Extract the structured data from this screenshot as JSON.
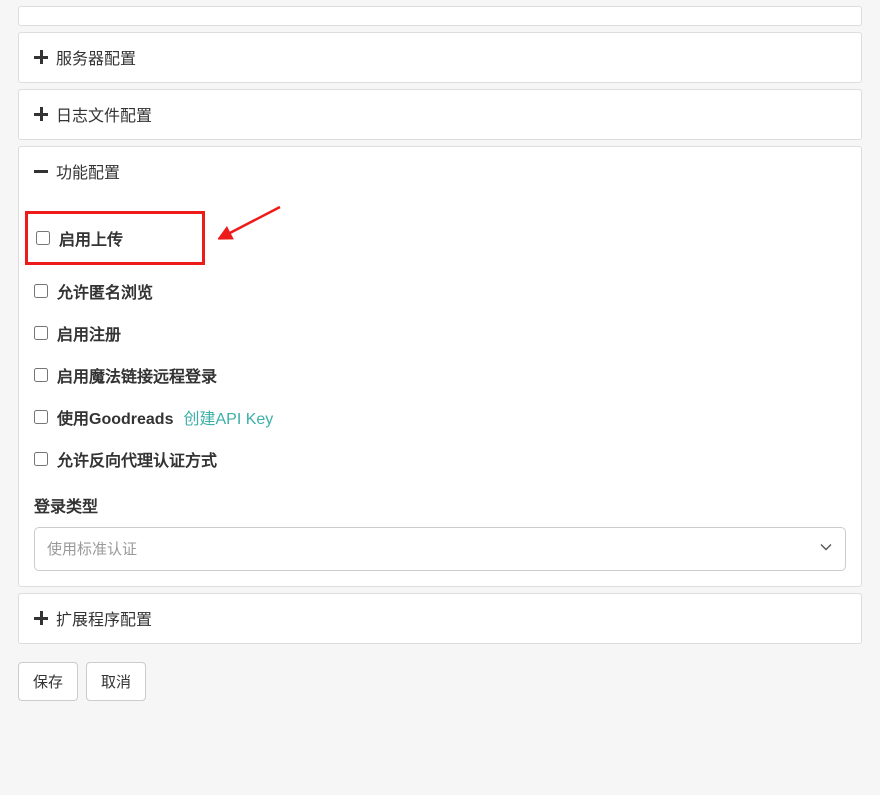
{
  "panels": {
    "server": {
      "title": "服务器配置"
    },
    "logfile": {
      "title": "日志文件配置"
    },
    "feature": {
      "title": "功能配置"
    },
    "extension": {
      "title": "扩展程序配置"
    }
  },
  "feature": {
    "enable_upload": "启用上传",
    "anon_browse": "允许匿名浏览",
    "enable_register": "启用注册",
    "enable_magic": "启用魔法链接远程登录",
    "use_goodreads": "使用Goodreads",
    "create_api_key": "创建API Key",
    "reverse_proxy_auth": "允许反向代理认证方式",
    "login_type_label": "登录类型",
    "login_type_selected": "使用标准认证"
  },
  "buttons": {
    "save": "保存",
    "cancel": "取消"
  }
}
